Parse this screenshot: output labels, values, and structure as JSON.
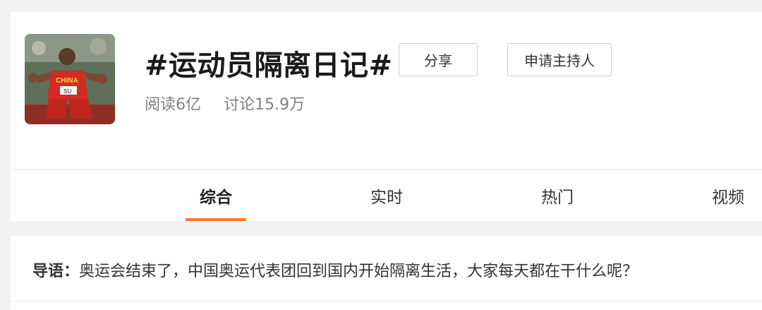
{
  "topic": {
    "title": "#运动员隔离日记#",
    "cover_alt": "athlete-photo",
    "cover_jersey_text": "CHINA",
    "cover_bib_text": "SU"
  },
  "actions": {
    "share_label": "分享",
    "apply_host_label": "申请主持人"
  },
  "stats": {
    "reads": "阅读6亿",
    "discussions": "讨论15.9万"
  },
  "tabs": [
    {
      "label": "综合",
      "active": true
    },
    {
      "label": "实时",
      "active": false
    },
    {
      "label": "热门",
      "active": false
    },
    {
      "label": "视频",
      "active": false
    }
  ],
  "intro": {
    "label": "导语：",
    "text": "奥运会结束了，中国奥运代表团回到国内开始隔离生活，大家每天都在干什么呢？"
  },
  "colors": {
    "accent": "#ff7a2e",
    "page_bg": "#f2f2f2",
    "card_bg": "#ffffff"
  }
}
